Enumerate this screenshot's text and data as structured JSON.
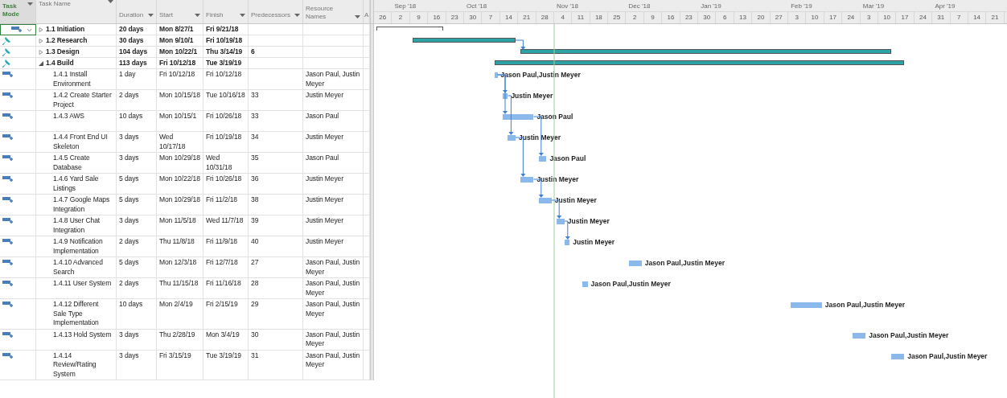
{
  "columns": [
    {
      "label": "Task Mode",
      "kind": "mode"
    },
    {
      "label": "Task Name",
      "kind": "name"
    },
    {
      "label": "Duration",
      "kind": "duration"
    },
    {
      "label": "Start",
      "kind": "start"
    },
    {
      "label": "Finish",
      "kind": "finish"
    },
    {
      "label": "Predecessors",
      "kind": "predecessors"
    },
    {
      "label": "Resource Names",
      "kind": "resources"
    },
    {
      "label": "A",
      "kind": "cut"
    }
  ],
  "timescale": {
    "weeks": [
      {
        "label": "26"
      },
      {
        "label": "2",
        "month": "Sep '18"
      },
      {
        "label": "9"
      },
      {
        "label": "16"
      },
      {
        "label": "23"
      },
      {
        "label": "30",
        "month": "Oct '18"
      },
      {
        "label": "7"
      },
      {
        "label": "14"
      },
      {
        "label": "21"
      },
      {
        "label": "28"
      },
      {
        "label": "4",
        "month": "Nov '18"
      },
      {
        "label": "11"
      },
      {
        "label": "18"
      },
      {
        "label": "25"
      },
      {
        "label": "2",
        "month": "Dec '18"
      },
      {
        "label": "9"
      },
      {
        "label": "16"
      },
      {
        "label": "23"
      },
      {
        "label": "30",
        "month": "Jan '19"
      },
      {
        "label": "6"
      },
      {
        "label": "13"
      },
      {
        "label": "20"
      },
      {
        "label": "27"
      },
      {
        "label": "3",
        "month": "Feb '19"
      },
      {
        "label": "10"
      },
      {
        "label": "17"
      },
      {
        "label": "24"
      },
      {
        "label": "3",
        "month": "Mar '19"
      },
      {
        "label": "10"
      },
      {
        "label": "17"
      },
      {
        "label": "24"
      },
      {
        "label": "31",
        "month": "Apr '19"
      },
      {
        "label": "7"
      },
      {
        "label": "14"
      },
      {
        "label": "21"
      }
    ]
  },
  "rows": [
    {
      "kind": "summary",
      "manual": false,
      "selected": true,
      "expanded": false,
      "hollow": true,
      "wbs": "1.1",
      "name": "Initiation",
      "duration": "20 days",
      "start": "Mon 8/27/1",
      "finish": "Fri 9/21/18"
    },
    {
      "kind": "summary",
      "manual": true,
      "selected": false,
      "expanded": false,
      "hollow": false,
      "wbs": "1.2",
      "name": "Research",
      "duration": "30 days",
      "start": "Mon 9/10/1",
      "finish": "Fri 10/19/18"
    },
    {
      "kind": "summary",
      "manual": true,
      "selected": false,
      "expanded": false,
      "hollow": false,
      "wbs": "1.3",
      "name": "Design",
      "duration": "104 days",
      "start": "Mon 10/22/1",
      "finish": "Thu 3/14/19",
      "predecessors": "6"
    },
    {
      "kind": "summary",
      "manual": true,
      "selected": false,
      "expanded": true,
      "hollow": false,
      "wbs": "1.4",
      "name": "Build",
      "duration": "113 days",
      "start": "Fri 10/12/18",
      "finish": "Tue 3/19/19"
    },
    {
      "kind": "task",
      "manual": false,
      "selected": false,
      "wbs": "1.4.1",
      "name": "Install Environment",
      "duration": "1 day",
      "start": "Fri 10/12/18",
      "finish": "Fri 10/12/18",
      "resources": "Jason Paul, Justin Meyer",
      "bar_label": "Jason Paul,Justin Meyer"
    },
    {
      "kind": "task",
      "manual": false,
      "selected": false,
      "wbs": "1.4.2",
      "name": "Create Starter Project",
      "duration": "2 days",
      "start": "Mon 10/15/18",
      "finish": "Tue 10/16/18",
      "predecessors": "33",
      "resources": "Justin Meyer",
      "bar_label": "Justin Meyer"
    },
    {
      "kind": "task",
      "manual": false,
      "selected": false,
      "wbs": "1.4.3",
      "name": "AWS",
      "duration": "10 days",
      "start": "Mon 10/15/1",
      "finish": "Fri 10/26/18",
      "predecessors": "33",
      "resources": "Jason Paul",
      "bar_label": "Jason Paul"
    },
    {
      "kind": "task",
      "manual": false,
      "selected": false,
      "wbs": "1.4.4",
      "name": "Front End UI Skeleton",
      "duration": "3 days",
      "start": "Wed 10/17/18",
      "finish": "Fri 10/19/18",
      "predecessors": "34",
      "resources": "Justin Meyer",
      "bar_label": "Justin Meyer"
    },
    {
      "kind": "task",
      "manual": false,
      "selected": false,
      "wbs": "1.4.5",
      "name": "Create Database",
      "duration": "3 days",
      "start": "Mon 10/29/18",
      "finish": "Wed 10/31/18",
      "predecessors": "35",
      "resources": "Jason Paul",
      "bar_label": "Jason Paul"
    },
    {
      "kind": "task",
      "manual": false,
      "selected": false,
      "wbs": "1.4.6",
      "name": "Yard Sale Listings",
      "duration": "5 days",
      "start": "Mon 10/22/18",
      "finish": "Fri 10/26/18",
      "predecessors": "36",
      "resources": "Justin Meyer",
      "bar_label": "Justin Meyer"
    },
    {
      "kind": "task",
      "manual": false,
      "selected": false,
      "wbs": "1.4.7",
      "name": "Google Maps Integration",
      "duration": "5 days",
      "start": "Mon 10/29/18",
      "finish": "Fri 11/2/18",
      "predecessors": "38",
      "resources": "Justin Meyer",
      "bar_label": "Justin Meyer"
    },
    {
      "kind": "task",
      "manual": false,
      "selected": false,
      "wbs": "1.4.8",
      "name": "User Chat Integration",
      "duration": "3 days",
      "start": "Mon 11/5/18",
      "finish": "Wed 11/7/18",
      "predecessors": "39",
      "resources": "Justin Meyer",
      "bar_label": "Justin Meyer"
    },
    {
      "kind": "task",
      "manual": false,
      "selected": false,
      "wbs": "1.4.9",
      "name": "Notification Implementation",
      "duration": "2 days",
      "start": "Thu 11/8/18",
      "finish": "Fri 11/9/18",
      "predecessors": "40",
      "resources": "Justin Meyer",
      "bar_label": "Justin Meyer"
    },
    {
      "kind": "task",
      "manual": false,
      "selected": false,
      "wbs": "1.4.10",
      "name": "Advanced Search",
      "duration": "5 days",
      "start": "Mon 12/3/18",
      "finish": "Fri 12/7/18",
      "predecessors": "27",
      "resources": "Jason Paul, Justin Meyer",
      "bar_label": "Jason Paul,Justin Meyer"
    },
    {
      "kind": "task",
      "manual": false,
      "selected": false,
      "wbs": "1.4.11",
      "name": "User System",
      "duration": "2 days",
      "start": "Thu 11/15/18",
      "finish": "Fri 11/16/18",
      "predecessors": "28",
      "resources": "Jason Paul, Justin Meyer",
      "bar_label": "Jason Paul,Justin Meyer"
    },
    {
      "kind": "task",
      "manual": false,
      "selected": false,
      "wbs": "1.4.12",
      "name": "Different Sale Type Implementation",
      "duration": "10 days",
      "start": "Mon 2/4/19",
      "finish": "Fri 2/15/19",
      "predecessors": "29",
      "resources": "Jason Paul, Justin Meyer",
      "bar_label": "Jason Paul,Justin Meyer"
    },
    {
      "kind": "task",
      "manual": false,
      "selected": false,
      "wbs": "1.4.13",
      "name": "Hold System",
      "duration": "3 days",
      "start": "Thu 2/28/19",
      "finish": "Mon 3/4/19",
      "predecessors": "30",
      "resources": "Jason Paul, Justin Meyer",
      "bar_label": "Jason Paul,Justin Meyer"
    },
    {
      "kind": "task",
      "manual": false,
      "selected": false,
      "wbs": "1.4.14",
      "name": "Review/Rating System",
      "duration": "3 days",
      "start": "Fri 3/15/19",
      "finish": "Tue 3/19/19",
      "predecessors": "31",
      "resources": "Jason Paul, Justin Meyer",
      "bar_label": "Jason Paul,Justin Meyer"
    }
  ]
}
